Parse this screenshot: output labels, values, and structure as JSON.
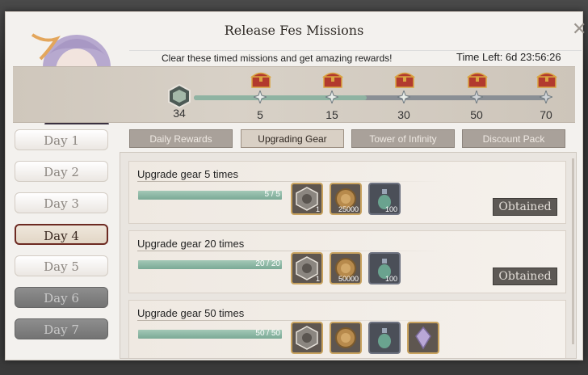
{
  "header": {
    "title": "Release Fes Missions",
    "subtitle": "Clear these timed missions and get amazing rewards!",
    "time_left": "Time Left: 6d 23:56:26",
    "close_glyph": "✕"
  },
  "progress": {
    "current": "34",
    "max": 70,
    "fraction": 0.486,
    "milestones": [
      {
        "value": "5",
        "reached": true
      },
      {
        "value": "15",
        "reached": true
      },
      {
        "value": "30",
        "reached": true
      },
      {
        "value": "50",
        "reached": false
      },
      {
        "value": "70",
        "reached": false
      }
    ]
  },
  "days": [
    {
      "label": "Day 1",
      "state": "normal"
    },
    {
      "label": "Day 2",
      "state": "normal"
    },
    {
      "label": "Day 3",
      "state": "normal"
    },
    {
      "label": "Day 4",
      "state": "selected"
    },
    {
      "label": "Day 5",
      "state": "normal"
    },
    {
      "label": "Day 6",
      "state": "locked"
    },
    {
      "label": "Day 7",
      "state": "locked"
    }
  ],
  "tabs": [
    {
      "label": "Daily Rewards",
      "selected": false
    },
    {
      "label": "Upgrading Gear",
      "selected": true
    },
    {
      "label": "Tower of Infinity",
      "selected": false
    },
    {
      "label": "Discount Pack",
      "selected": false
    }
  ],
  "missions": [
    {
      "title": "Upgrade gear 5 times",
      "progress_text": "5 / 5",
      "progress_fraction": 1.0,
      "rewards": [
        {
          "icon": "gear-crate-icon",
          "qty": "1",
          "style": "gold"
        },
        {
          "icon": "coin-icon",
          "qty": "25000",
          "style": "gold"
        },
        {
          "icon": "potion-icon",
          "qty": "100",
          "style": "dark"
        }
      ],
      "status": "Obtained"
    },
    {
      "title": "Upgrade gear 20 times",
      "progress_text": "20 / 20",
      "progress_fraction": 1.0,
      "rewards": [
        {
          "icon": "gear-crate-icon",
          "qty": "1",
          "style": "gold"
        },
        {
          "icon": "coin-icon",
          "qty": "50000",
          "style": "gold"
        },
        {
          "icon": "potion-icon",
          "qty": "100",
          "style": "dark"
        }
      ],
      "status": "Obtained"
    },
    {
      "title": "Upgrade gear 50 times",
      "progress_text": "50 / 50",
      "progress_fraction": 1.0,
      "rewards": [
        {
          "icon": "gear-crate-icon",
          "qty": "",
          "style": "gold"
        },
        {
          "icon": "coin-icon",
          "qty": "",
          "style": "gold"
        },
        {
          "icon": "potion-icon",
          "qty": "",
          "style": "dark"
        },
        {
          "icon": "crystal-icon",
          "qty": "",
          "style": "gold"
        }
      ],
      "status": ""
    }
  ],
  "colors": {
    "accent_selected_border": "#6d2a22",
    "progress_fill": "#8fb3a2",
    "chest_red": "#b23a2e",
    "chest_gold": "#d9a441"
  }
}
